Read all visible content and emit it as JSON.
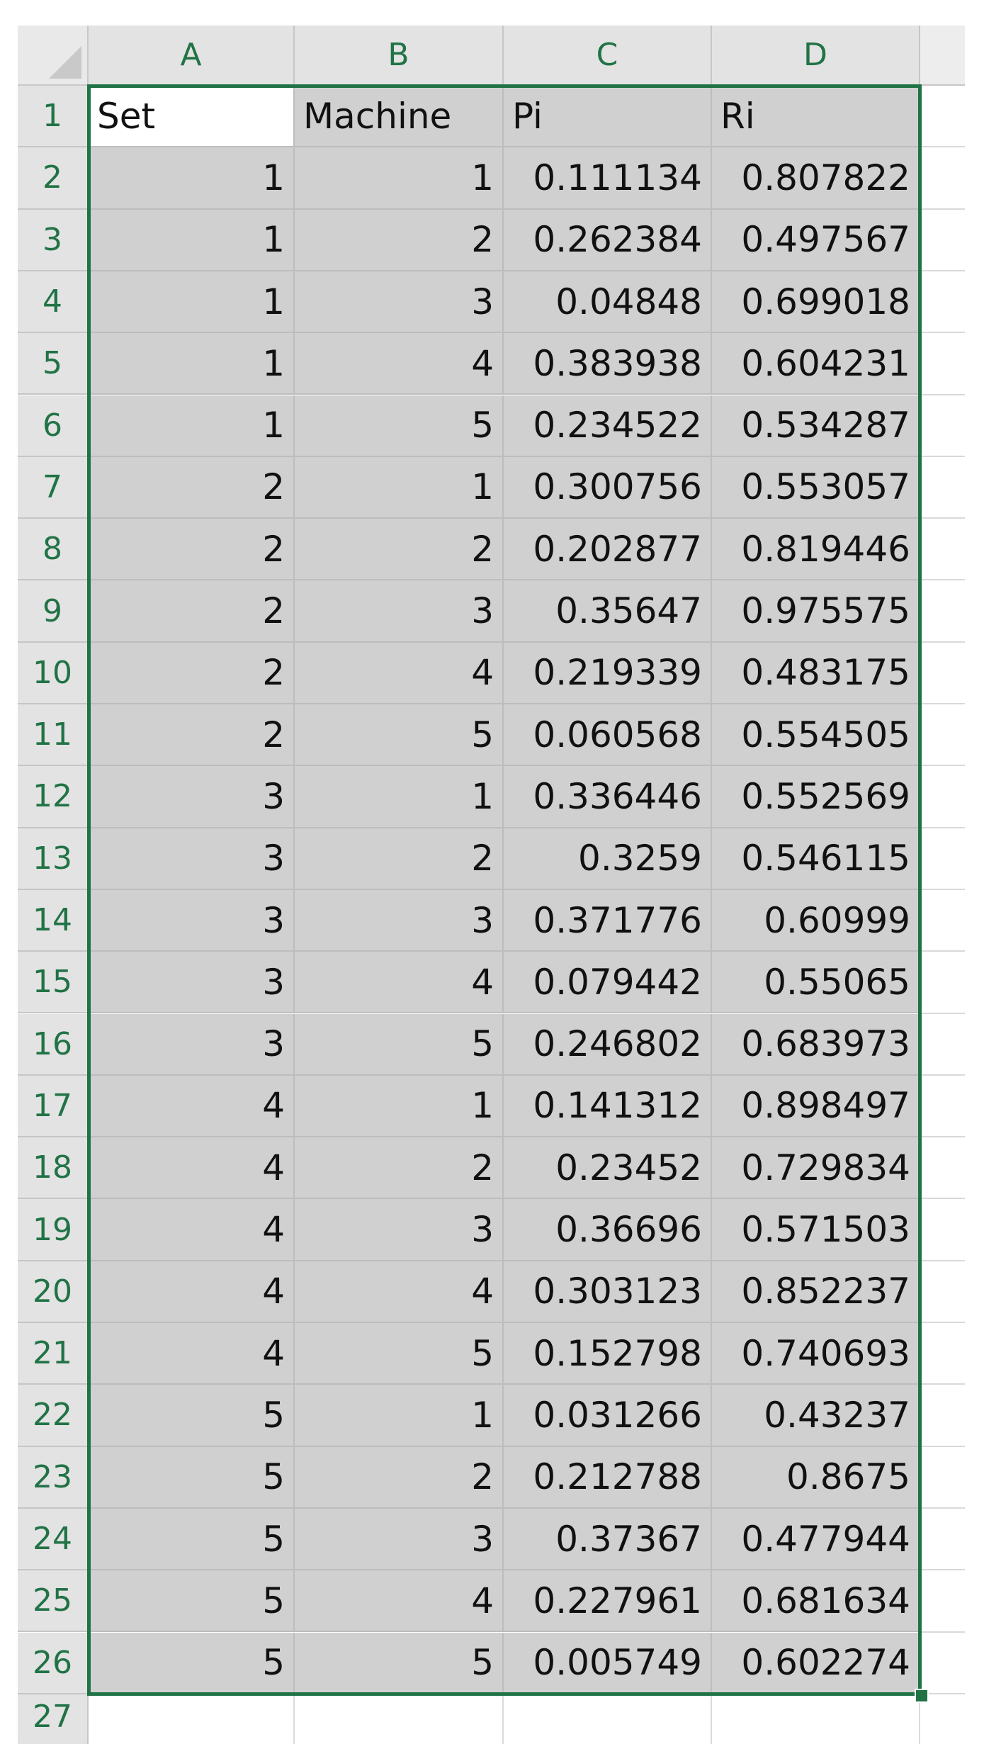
{
  "sheet": {
    "columns": [
      "A",
      "B",
      "C",
      "D"
    ],
    "extra_row": "27",
    "table": {
      "headers": [
        "Set",
        "Machine",
        "Pi",
        "Ri"
      ],
      "rows": [
        [
          "1",
          "1",
          "0.111134",
          "0.807822"
        ],
        [
          "1",
          "2",
          "0.262384",
          "0.497567"
        ],
        [
          "1",
          "3",
          "0.04848",
          "0.699018"
        ],
        [
          "1",
          "4",
          "0.383938",
          "0.604231"
        ],
        [
          "1",
          "5",
          "0.234522",
          "0.534287"
        ],
        [
          "2",
          "1",
          "0.300756",
          "0.553057"
        ],
        [
          "2",
          "2",
          "0.202877",
          "0.819446"
        ],
        [
          "2",
          "3",
          "0.35647",
          "0.975575"
        ],
        [
          "2",
          "4",
          "0.219339",
          "0.483175"
        ],
        [
          "2",
          "5",
          "0.060568",
          "0.554505"
        ],
        [
          "3",
          "1",
          "0.336446",
          "0.552569"
        ],
        [
          "3",
          "2",
          "0.3259",
          "0.546115"
        ],
        [
          "3",
          "3",
          "0.371776",
          "0.60999"
        ],
        [
          "3",
          "4",
          "0.079442",
          "0.55065"
        ],
        [
          "3",
          "5",
          "0.246802",
          "0.683973"
        ],
        [
          "4",
          "1",
          "0.141312",
          "0.898497"
        ],
        [
          "4",
          "2",
          "0.23452",
          "0.729834"
        ],
        [
          "4",
          "3",
          "0.36696",
          "0.571503"
        ],
        [
          "4",
          "4",
          "0.303123",
          "0.852237"
        ],
        [
          "4",
          "5",
          "0.152798",
          "0.740693"
        ],
        [
          "5",
          "1",
          "0.031266",
          "0.43237"
        ],
        [
          "5",
          "2",
          "0.212788",
          "0.8675"
        ],
        [
          "5",
          "3",
          "0.37367",
          "0.477944"
        ],
        [
          "5",
          "4",
          "0.227961",
          "0.681634"
        ],
        [
          "5",
          "5",
          "0.005749",
          "0.602274"
        ]
      ]
    }
  },
  "colors": {
    "selection_border": "#217346",
    "header_text": "#217346",
    "selected_fill": "#d0d0d0",
    "header_fill": "#e3e3e3"
  }
}
